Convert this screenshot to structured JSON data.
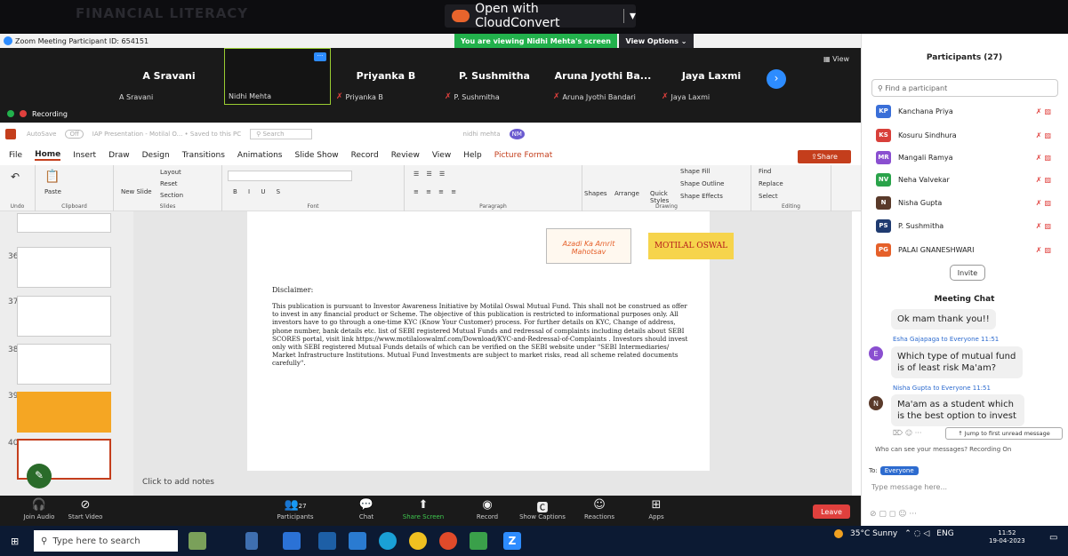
{
  "browser": {
    "search_ghost": "FINANCIAL LITERACY",
    "cloudconvert": "Open with CloudConvert"
  },
  "zoom": {
    "title": "Zoom Meeting Participant ID: 654151",
    "viewing_banner": "You are viewing Nidhi Mehta's screen",
    "view_options": "View Options",
    "view_button": "View",
    "recording": "Recording",
    "gallery": [
      {
        "name": "A Sravani",
        "label": "A Sravani"
      },
      {
        "name": "",
        "label": "Nidhi Mehta"
      },
      {
        "name": "Priyanka B",
        "label": "Priyanka B"
      },
      {
        "name": "P. Sushmitha",
        "label": "P. Sushmitha"
      },
      {
        "name": "Aruna Jyothi Ba...",
        "label": "Aruna Jyothi Bandari"
      },
      {
        "name": "Jaya Laxmi",
        "label": "Jaya Laxmi"
      }
    ],
    "toolbar": {
      "join_audio": "Join Audio",
      "start_video": "Start Video",
      "participants": "Participants",
      "participants_count": "27",
      "chat": "Chat",
      "share_screen": "Share Screen",
      "record": "Record",
      "show_captions": "Show Captions",
      "reactions": "Reactions",
      "apps": "Apps",
      "leave": "Leave"
    }
  },
  "ppt": {
    "autosave": "AutoSave",
    "autosave_state": "Off",
    "doc_title": "IAP Presentation - Motilal O... • Saved to this PC",
    "search": "Search",
    "user": "nidhi mehta",
    "user_initials": "NM",
    "tabs": [
      "File",
      "Home",
      "Insert",
      "Draw",
      "Design",
      "Transitions",
      "Animations",
      "Slide Show",
      "Record",
      "Review",
      "View",
      "Help",
      "Picture Format"
    ],
    "share": "Share",
    "ribbon_groups": {
      "undo": "Undo",
      "clipboard": "Clipboard",
      "slides": "Slides",
      "font": "Font",
      "paragraph": "Paragraph",
      "drawing": "Drawing",
      "editing": "Editing"
    },
    "ribbon": {
      "paste": "Paste",
      "new_slide": "New Slide",
      "layout": "Layout",
      "reset": "Reset",
      "section": "Section",
      "shapes": "Shapes",
      "arrange": "Arrange",
      "quick_styles": "Quick Styles",
      "shape_fill": "Shape Fill",
      "shape_outline": "Shape Outline",
      "shape_effects": "Shape Effects",
      "find": "Find",
      "replace": "Replace",
      "select": "Select"
    },
    "thumb_numbers": [
      "36",
      "37",
      "38",
      "39",
      "40"
    ],
    "disclaimer_title": "Disclaimer:",
    "disclaimer_body": "This publication is pursuant to Investor Awareness Initiative by Motilal Oswal Mutual Fund. This shall not be construed as offer to invest in any financial product or Scheme. The objective of this publication is restricted to informational purposes only. All investors have to go through a one-time KYC (Know Your Customer) process. For further details on KYC, Change of address, phone number, bank details etc. list of SEBI registered Mutual Funds and redressal of complaints including details about SEBI SCORES portal, visit link https://www.motilaloswalmf.com/Download/KYC-and-Redressal-of-Complaints . Investors should invest only with SEBI registered Mutual Funds details of which can be verified on the SEBI website under \"SEBI Intermediaries/ Market Infrastructure Institutions. Mutual Fund Investments are subject to market risks, read all scheme related documents carefully\".",
    "azadi_logo": "Azadi Ka Amrit Mahotsav",
    "motilal_logo": "MOTILAL OSWAL",
    "notes": "Click to add notes"
  },
  "participants": {
    "title": "Participants (27)",
    "search_placeholder": "Find a participant",
    "list": [
      {
        "initials": "KP",
        "name": "Kanchana Priya",
        "color": "#3a6fd8"
      },
      {
        "initials": "KS",
        "name": "Kosuru Sindhura",
        "color": "#d8403a"
      },
      {
        "initials": "MR",
        "name": "Mangali Ramya",
        "color": "#8a4fd0"
      },
      {
        "initials": "NV",
        "name": "Neha Valvekar",
        "color": "#2aa34a"
      },
      {
        "initials": "N",
        "name": "Nisha Gupta",
        "color": "#5a3a2a"
      },
      {
        "initials": "PS",
        "name": "P. Sushmitha",
        "color": "#1f3b70"
      },
      {
        "initials": "PG",
        "name": "PALAI GNANESHWARI",
        "color": "#e5602a"
      }
    ],
    "invite": "Invite"
  },
  "chat": {
    "title": "Meeting Chat",
    "messages": [
      {
        "meta": "",
        "text": "Ok mam thank you!!"
      },
      {
        "meta": "Esha Gajapaga to Everyone 11:51",
        "text": "Which type of mutual fund is of least risk Ma'am?",
        "initial": "E"
      },
      {
        "meta": "Nisha Gupta to Everyone 11:51",
        "text": "Ma'am as a student which is the best option to invest",
        "initial": "N"
      }
    ],
    "jump": "Jump to first unread message",
    "who_can": "Who can see your messages? Recording On",
    "to": "To:",
    "to_target": "Everyone",
    "placeholder": "Type message here..."
  },
  "taskbar": {
    "search": "Type here to search",
    "weather": "35°C Sunny",
    "lang": "ENG",
    "time": "11:52",
    "date": "19-04-2023"
  }
}
